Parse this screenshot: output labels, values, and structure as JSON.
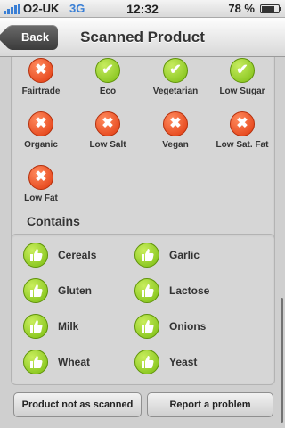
{
  "status_bar": {
    "carrier": "O2-UK",
    "network": "3G",
    "time": "12:32",
    "battery_percent": "78 %",
    "battery_level": 0.78
  },
  "nav": {
    "back_label": "Back",
    "title": "Scanned Product"
  },
  "attributes": [
    {
      "label": "Fairtrade",
      "status": "no"
    },
    {
      "label": "Eco",
      "status": "yes"
    },
    {
      "label": "Vegetarian",
      "status": "yes"
    },
    {
      "label": "Low Sugar",
      "status": "yes"
    },
    {
      "label": "Organic",
      "status": "no"
    },
    {
      "label": "Low Salt",
      "status": "no"
    },
    {
      "label": "Vegan",
      "status": "no"
    },
    {
      "label": "Low Sat. Fat",
      "status": "no"
    },
    {
      "label": "Low Fat",
      "status": "no"
    }
  ],
  "contains": {
    "title": "Contains",
    "items": [
      "Cereals",
      "Garlic",
      "Gluten",
      "Lactose",
      "Milk",
      "Onions",
      "Wheat",
      "Yeast"
    ]
  },
  "actions": {
    "not_as_scanned": "Product not as scanned",
    "report": "Report a problem"
  },
  "colors": {
    "accent_yes": "#7cbd12",
    "accent_no": "#e0380e",
    "network": "#3a7fd5"
  },
  "icons": {
    "yes": "check-icon",
    "no": "cross-icon",
    "ingredient": "thumbs-up-icon"
  }
}
